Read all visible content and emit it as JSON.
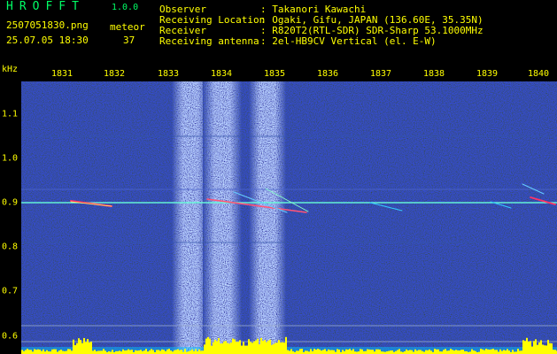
{
  "header": {
    "app_name": "HROFFT",
    "version": "1.0.0",
    "file_name": "2507051830.png",
    "meteor_label": "meteor",
    "datetime": "25.07.05 18:30",
    "meteor_count": "37",
    "info": [
      {
        "label": "Observer",
        "value": ": Takanori Kawachi"
      },
      {
        "label": "Receiving Location",
        "value": ": Ogaki, Gifu, JAPAN (136.60E, 35.35N)"
      },
      {
        "label": "Receiver",
        "value": ": R820T2(RTL-SDR) SDR-Sharp 53.1000MHz"
      },
      {
        "label": "Receiving antenna",
        "value": ": 2el-HB9CV Vertical (el. E-W)"
      }
    ]
  },
  "axes": {
    "y_unit": "kHz",
    "x_ticks": [
      "1831",
      "1832",
      "1833",
      "1834",
      "1835",
      "1836",
      "1837",
      "1838",
      "1839",
      "1840"
    ],
    "y_ticks": [
      "1.1",
      "1.0",
      "0.9",
      "0.8",
      "0.7",
      "0.6"
    ]
  },
  "colors": {
    "label": "#ffff00",
    "title": "#00ff66",
    "carrier": "#33ffcc",
    "noise_floor": "#ffff00"
  }
}
